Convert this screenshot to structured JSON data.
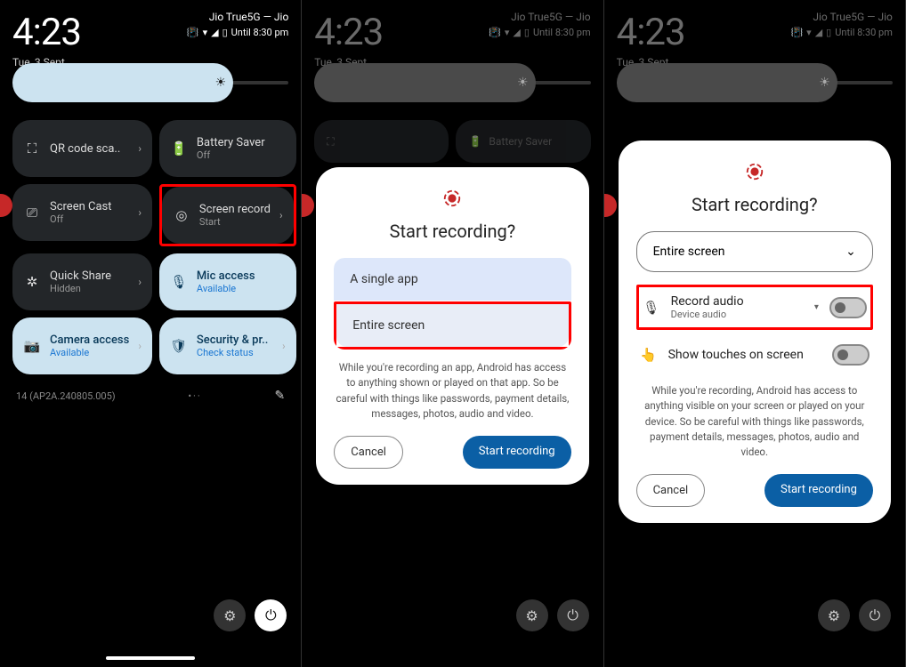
{
  "status": {
    "time": "4:23",
    "date": "Tue, 3 Sept",
    "carrier": "Jio True5G — Jio",
    "until": "Until 8:30 pm"
  },
  "tiles": {
    "qr": {
      "title": "QR code sca.."
    },
    "battery": {
      "title": "Battery Saver",
      "sub": "Off"
    },
    "cast": {
      "title": "Screen Cast",
      "sub": "Off"
    },
    "record": {
      "title": "Screen record",
      "sub": "Start"
    },
    "quickshare": {
      "title": "Quick Share",
      "sub": "Hidden"
    },
    "mic": {
      "title": "Mic access",
      "sub": "Available"
    },
    "camera": {
      "title": "Camera access",
      "sub": "Available"
    },
    "security": {
      "title": "Security & pr..",
      "sub": "Check status"
    }
  },
  "build": "14 (AP2A.240805.005)",
  "bgtile_battery": "Battery Saver",
  "dialog": {
    "title": "Start recording?",
    "opt_single": "A single app",
    "opt_entire": "Entire screen",
    "select_label": "Entire screen",
    "rec_audio_title": "Record audio",
    "rec_audio_sub": "Device audio",
    "show_touches": "Show touches on screen",
    "disclaimer1": "While you're recording an app, Android has access to anything shown or played on that app. So be careful with things like passwords, payment details, messages, photos, audio and video.",
    "disclaimer2": "While you're recording, Android has access to anything visible on your screen or played on your device. So be careful with things like passwords, payment details, messages, photos, audio and video.",
    "cancel": "Cancel",
    "start": "Start recording"
  }
}
